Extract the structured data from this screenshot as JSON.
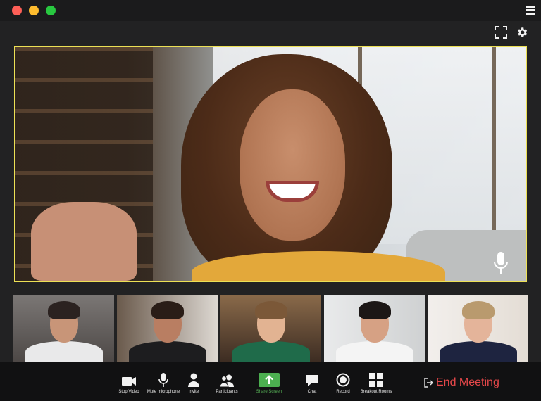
{
  "window": {
    "controls": [
      "close",
      "minimize",
      "maximize"
    ],
    "menu_icon": "hamburger-icon"
  },
  "top_icons": [
    "fullscreen-icon",
    "gear-icon"
  ],
  "main_video": {
    "speaker_highlight_color": "#ece055",
    "mic_icon": "microphone-icon"
  },
  "participants": [
    {
      "id": "p1"
    },
    {
      "id": "p2"
    },
    {
      "id": "p3"
    },
    {
      "id": "p4"
    },
    {
      "id": "p5"
    }
  ],
  "toolbar": {
    "stop_video": "Stop Video",
    "mute_microphone": "Mute microphone",
    "invite": "Invite",
    "participants": "Participants",
    "share_screen": "Share Screen",
    "chat": "Chat",
    "record": "Record",
    "breakout_rooms": "Breakout Rooms",
    "end_meeting": "End Meeting",
    "share_color": "#4caf50",
    "end_color": "#e7484a"
  }
}
